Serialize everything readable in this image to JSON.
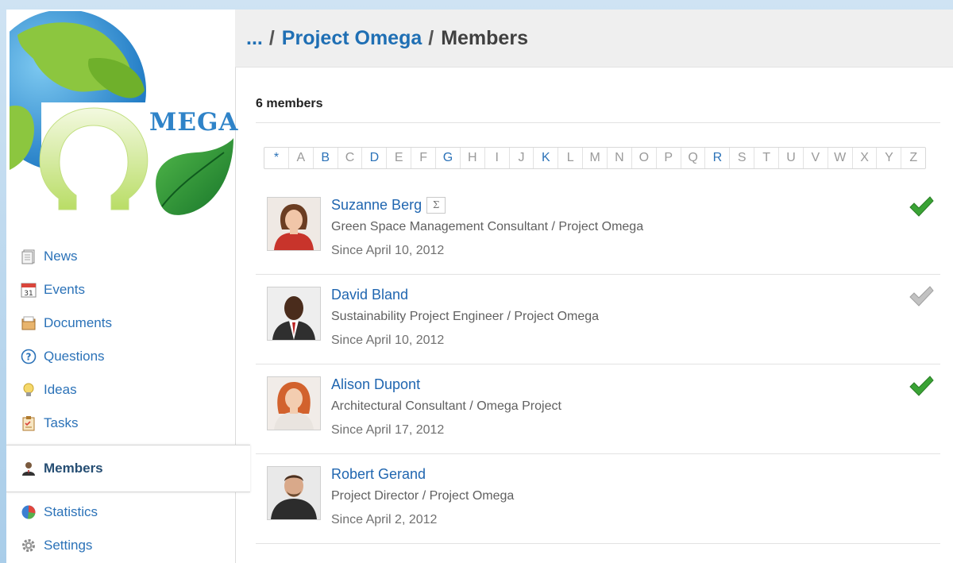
{
  "header": {
    "ellipsis": "...",
    "sep": "/",
    "project": "Project Omega",
    "current": "Members"
  },
  "logo": {
    "text": "MEGA"
  },
  "nav": [
    {
      "label": "News",
      "icon": "news-icon"
    },
    {
      "label": "Events",
      "icon": "calendar-icon",
      "icon_text": "31"
    },
    {
      "label": "Documents",
      "icon": "documents-icon"
    },
    {
      "label": "Questions",
      "icon": "question-icon",
      "icon_text": "?"
    },
    {
      "label": "Ideas",
      "icon": "lightbulb-icon"
    },
    {
      "label": "Tasks",
      "icon": "tasks-icon"
    },
    {
      "label": "Members",
      "icon": "members-icon",
      "active": true
    },
    {
      "label": "Statistics",
      "icon": "pie-chart-icon"
    },
    {
      "label": "Settings",
      "icon": "gear-icon"
    }
  ],
  "members_count": "6 members",
  "alphabet": {
    "letters": [
      "*",
      "A",
      "B",
      "C",
      "D",
      "E",
      "F",
      "G",
      "H",
      "I",
      "J",
      "K",
      "L",
      "M",
      "N",
      "O",
      "P",
      "Q",
      "R",
      "S",
      "T",
      "U",
      "V",
      "W",
      "X",
      "Y",
      "Z"
    ],
    "active": [
      "*",
      "B",
      "D",
      "G",
      "K",
      "R"
    ]
  },
  "members": [
    {
      "name": "Suzanne Berg",
      "badge": "Σ",
      "role": "Green Space Management Consultant / Project Omega",
      "since": "Since April 10, 2012",
      "check": "green",
      "avatar": "woman-brown-hair"
    },
    {
      "name": "David Bland",
      "role": "Sustainability Project Engineer / Project Omega",
      "since": "Since April 10, 2012",
      "check": "grey",
      "avatar": "man-suit"
    },
    {
      "name": "Alison Dupont",
      "role": "Architectural Consultant / Omega Project",
      "since": "Since April 17, 2012",
      "check": "green",
      "avatar": "woman-red-hair"
    },
    {
      "name": "Robert Gerand",
      "role": "Project Director / Project Omega",
      "since": "Since April 2, 2012",
      "check": "none",
      "avatar": "man-beard"
    }
  ],
  "colors": {
    "link": "#2066b0",
    "check_green": "#3aa335",
    "check_grey": "#b5b5b5",
    "header_bg": "#efefef"
  }
}
